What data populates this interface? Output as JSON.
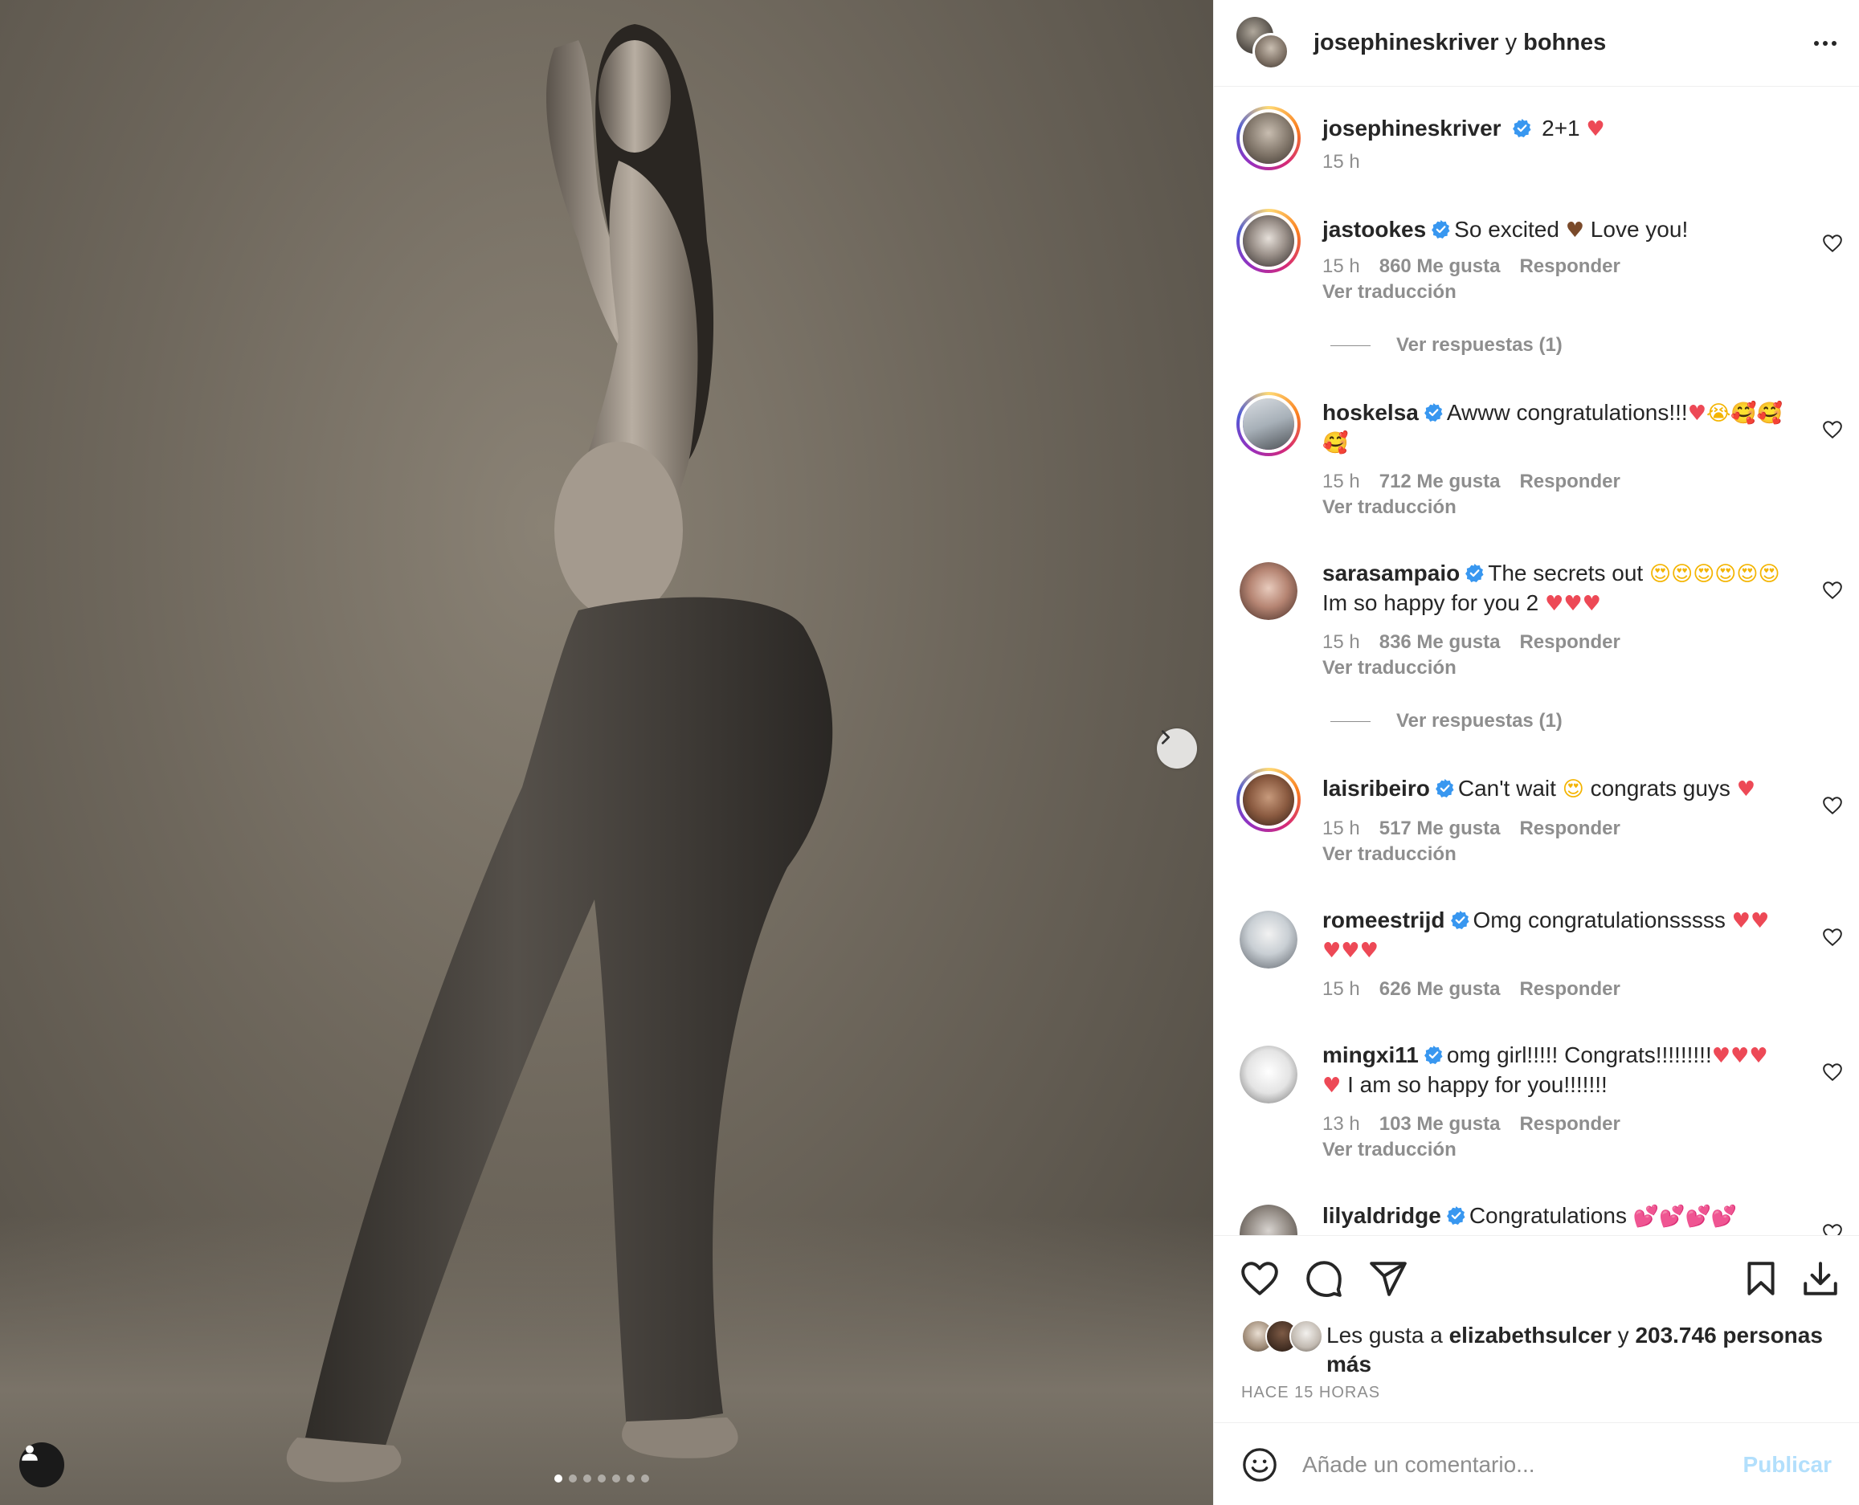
{
  "header": {
    "user1": "josephineskriver",
    "conjunction": "y",
    "user2": "bohnes"
  },
  "caption": {
    "username": "josephineskriver",
    "text": "2+1",
    "time": "15 h"
  },
  "comments": [
    {
      "username": "jastookes",
      "text": "So excited",
      "text_after": "Love you!",
      "time": "15 h",
      "likes": "860 Me gusta",
      "reply": "Responder",
      "translate": "Ver traducción",
      "view_replies": "Ver respuestas (1)"
    },
    {
      "username": "hoskelsa",
      "text": "Awww congratulations!!!",
      "time": "15 h",
      "likes": "712 Me gusta",
      "reply": "Responder",
      "translate": "Ver traducción"
    },
    {
      "username": "sarasampaio",
      "text": "The secrets out",
      "text_line2": "Im so happy for you 2",
      "time": "15 h",
      "likes": "836 Me gusta",
      "reply": "Responder",
      "translate": "Ver traducción",
      "view_replies": "Ver respuestas (1)"
    },
    {
      "username": "laisribeiro",
      "text": "Can't wait",
      "text_after": "congrats guys",
      "time": "15 h",
      "likes": "517 Me gusta",
      "reply": "Responder",
      "translate": "Ver traducción"
    },
    {
      "username": "romeestrijd",
      "text": "Omg congratulationsssss",
      "time": "15 h",
      "likes": "626 Me gusta",
      "reply": "Responder"
    },
    {
      "username": "mingxi11",
      "text": "omg girl!!!!! Congrats!!!!!!!!!",
      "text_line2": "I am so happy for you!!!!!!!",
      "time": "13 h",
      "likes": "103 Me gusta",
      "reply": "Responder",
      "translate": "Ver traducción"
    },
    {
      "username": "lilyaldridge",
      "text": "Congratulations"
    }
  ],
  "likes": {
    "prefix": "Les gusta a",
    "user": "elizabethsulcer",
    "conjunction": "y",
    "count": "203.746 personas más"
  },
  "timestamp": "HACE 15 HORAS",
  "comment_input": {
    "placeholder": "Añade un comentario...",
    "publish_label": "Publicar"
  },
  "carousel": {
    "total": 7,
    "current": 1
  },
  "colors": {
    "verified": "#3897f0",
    "heart_emoji": "#ed4956",
    "publish_disabled": "#b2dffc",
    "secondary_text": "#8e8e8e"
  },
  "icons": [
    "more-icon",
    "like-icon",
    "comment-icon",
    "share-icon",
    "save-icon",
    "download-icon",
    "emoji-icon",
    "next-arrow-icon",
    "user-tag-icon",
    "verified-badge-icon"
  ]
}
